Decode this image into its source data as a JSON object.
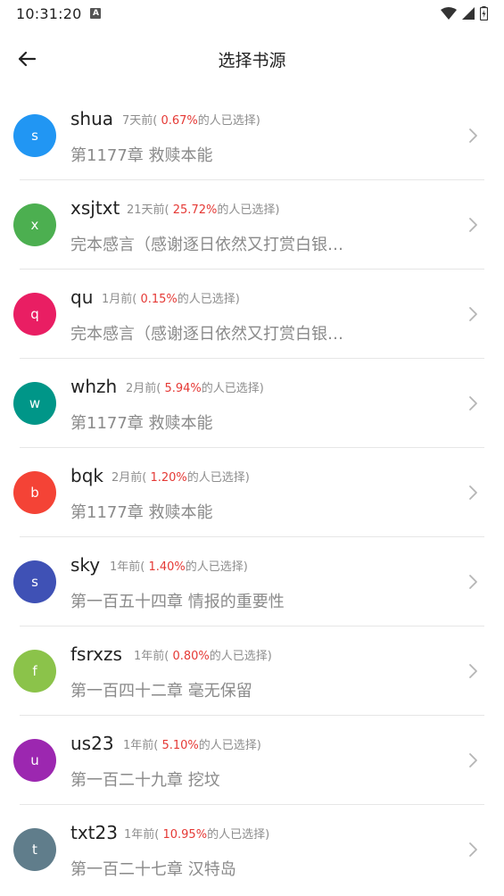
{
  "status_bar": {
    "time": "10:31:20",
    "notification_badge": "A"
  },
  "header": {
    "title": "选择书源"
  },
  "colors": {
    "percent_red": "#e53935",
    "meta_gray": "#8e8e8e"
  },
  "sources": [
    {
      "initial": "s",
      "name": "shua",
      "ago": "7天前(",
      "percent": "0.67%",
      "suffix": "的人已选择)",
      "chapter": "第1177章 救赎本能",
      "color": "#2196f3"
    },
    {
      "initial": "x",
      "name": "xsjtxt",
      "ago": "21天前(",
      "percent": "25.72%",
      "suffix": "的人已选择)",
      "chapter": "完本感言（感谢逐日依然又打赏白银…",
      "color": "#4caf50"
    },
    {
      "initial": "q",
      "name": "qu",
      "ago": "1月前(",
      "percent": "0.15%",
      "suffix": "的人已选择)",
      "chapter": "完本感言（感谢逐日依然又打赏白银…",
      "color": "#e91e63"
    },
    {
      "initial": "w",
      "name": "whzh",
      "ago": "2月前(",
      "percent": "5.94%",
      "suffix": "的人已选择)",
      "chapter": "第1177章 救赎本能",
      "color": "#009688"
    },
    {
      "initial": "b",
      "name": "bqk",
      "ago": "2月前(",
      "percent": "1.20%",
      "suffix": "的人已选择)",
      "chapter": "第1177章 救赎本能",
      "color": "#f44336"
    },
    {
      "initial": "s",
      "name": "sky",
      "ago": "1年前(",
      "percent": "1.40%",
      "suffix": "的人已选择)",
      "chapter": "第一百五十四章 情报的重要性",
      "color": "#3f51b5"
    },
    {
      "initial": "f",
      "name": "fsrxzs",
      "ago": "1年前(",
      "percent": "0.80%",
      "suffix": "的人已选择)",
      "chapter": "第一百四十二章 毫无保留",
      "color": "#8bc34a"
    },
    {
      "initial": "u",
      "name": "us23",
      "ago": "1年前(",
      "percent": "5.10%",
      "suffix": "的人已选择)",
      "chapter": "第一百二十九章 挖坟",
      "color": "#9c27b0"
    },
    {
      "initial": "t",
      "name": "txt23",
      "ago": "1年前(",
      "percent": "10.95%",
      "suffix": "的人已选择)",
      "chapter": "第一百二十七章 汉特岛",
      "color": "#607d8b"
    }
  ]
}
